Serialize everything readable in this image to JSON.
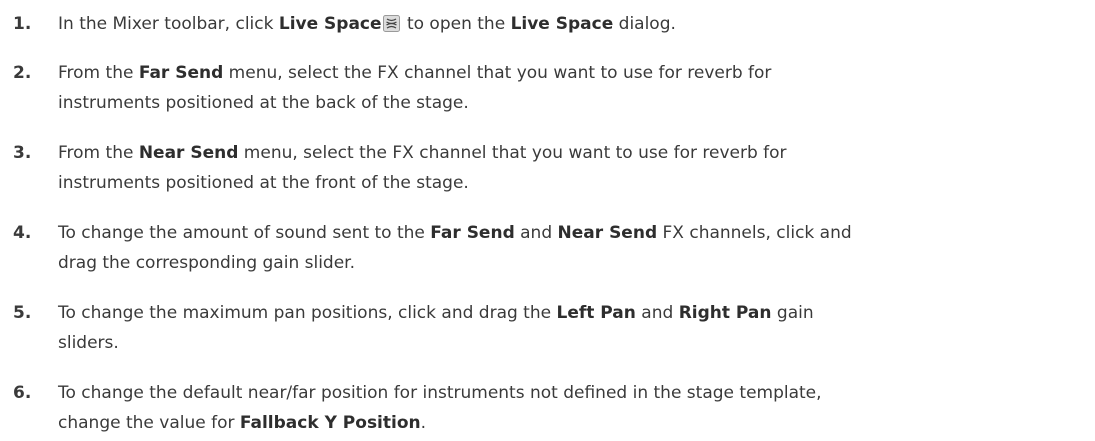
{
  "steps": [
    {
      "number": "1.",
      "parts": [
        "In the Mixer toolbar, click ",
        "Live Space",
        " to open the ",
        "Live Space",
        " dialog."
      ],
      "icon": "live-space-icon"
    },
    {
      "number": "2.",
      "line1": [
        "From the ",
        "Far Send",
        " menu, select the FX channel that you want to use for reverb for"
      ],
      "line2": "instruments positioned at the back of the stage."
    },
    {
      "number": "3.",
      "line1": [
        "From the ",
        "Near Send",
        " menu, select the FX channel that you want to use for reverb for"
      ],
      "line2": "instruments positioned at the front of the stage."
    },
    {
      "number": "4.",
      "line1": [
        "To change the amount of sound sent to the ",
        "Far Send",
        " and ",
        "Near Send",
        " FX channels, click and"
      ],
      "line2": "drag the corresponding gain slider."
    },
    {
      "number": "5.",
      "line1": [
        "To change the maximum pan positions, click and drag the ",
        "Left Pan",
        " and ",
        "Right Pan",
        " gain"
      ],
      "line2": "sliders."
    },
    {
      "number": "6.",
      "line1": "To change the default near/far position for instruments not defined in the stage template,",
      "line2": [
        "change the value for ",
        "Fallback Y Position",
        "."
      ]
    }
  ]
}
